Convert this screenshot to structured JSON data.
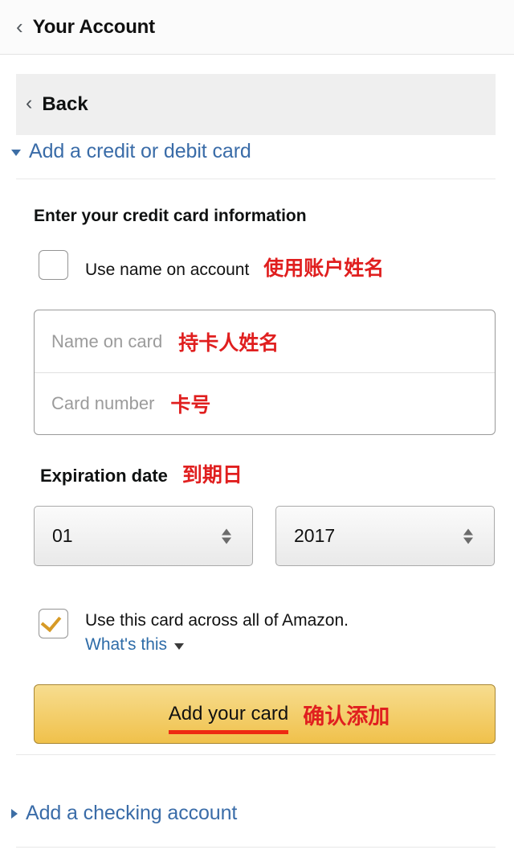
{
  "appbar": {
    "back_icon": "chevron-left-icon",
    "title": "Your Account"
  },
  "backbar": {
    "back_icon": "chevron-left-icon",
    "label": "Back"
  },
  "sections": {
    "credit_card": {
      "expander_icon": "triangle-down-icon",
      "label": "Add a credit or debit card",
      "expanded": true,
      "heading": "Enter your credit card information",
      "use_account_name": {
        "label": "Use name on account",
        "annotation_cn": "使用账户姓名",
        "checked": false
      },
      "fields": [
        {
          "name": "name-on-card",
          "placeholder": "Name on card",
          "value": "",
          "annotation_cn": "持卡人姓名"
        },
        {
          "name": "card-number",
          "placeholder": "Card number",
          "value": "",
          "annotation_cn": "卡号"
        }
      ],
      "expiration": {
        "label": "Expiration date",
        "annotation_cn": "到期日",
        "month": "01",
        "year": "2017"
      },
      "use_across_amazon": {
        "label": "Use this card across all of Amazon.",
        "help_link": "What's this",
        "help_caret_icon": "triangle-down-icon",
        "checked": true
      },
      "submit": {
        "label": "Add your card",
        "annotation_cn": "确认添加"
      }
    },
    "checking_account": {
      "expander_icon": "triangle-right-icon",
      "label": "Add a checking account",
      "expanded": false
    }
  },
  "colors": {
    "link_blue": "#3a6ca8",
    "annotation_red": "#e01f1f",
    "button_gold": "#f0c14b",
    "check_gold": "#d79a26",
    "underline_red": "#ee2a11"
  }
}
